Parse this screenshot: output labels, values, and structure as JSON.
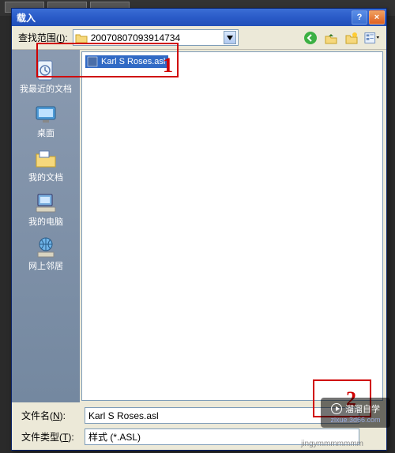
{
  "dialog": {
    "title": "载入",
    "help_btn": "?",
    "close_btn": "×"
  },
  "toolbar": {
    "lookin_label_pre": "查找范围(",
    "lookin_accel": "I",
    "lookin_label_post": "):",
    "folder_name": "20070807093914734"
  },
  "places": {
    "recent": "我最近的文档",
    "desktop": "桌面",
    "mydocs": "我的文档",
    "mycomputer": "我的电脑",
    "network": "网上邻居"
  },
  "file_list": {
    "selected_name": "Karl S Roses.asl"
  },
  "bottom": {
    "filename_label_pre": "文件名(",
    "filename_accel": "N",
    "filename_label_post": "):",
    "filename_value": "Karl S Roses.asl",
    "filetype_label_pre": "文件类型(",
    "filetype_accel": "T",
    "filetype_label_post": "):",
    "filetype_value": "样式 (*.ASL)"
  },
  "annotations": {
    "one": "1",
    "two": "2"
  },
  "watermark": {
    "brand": "溜溜自学",
    "url": "zixue.3d66.com"
  },
  "footer": "jingymmmmmmm"
}
